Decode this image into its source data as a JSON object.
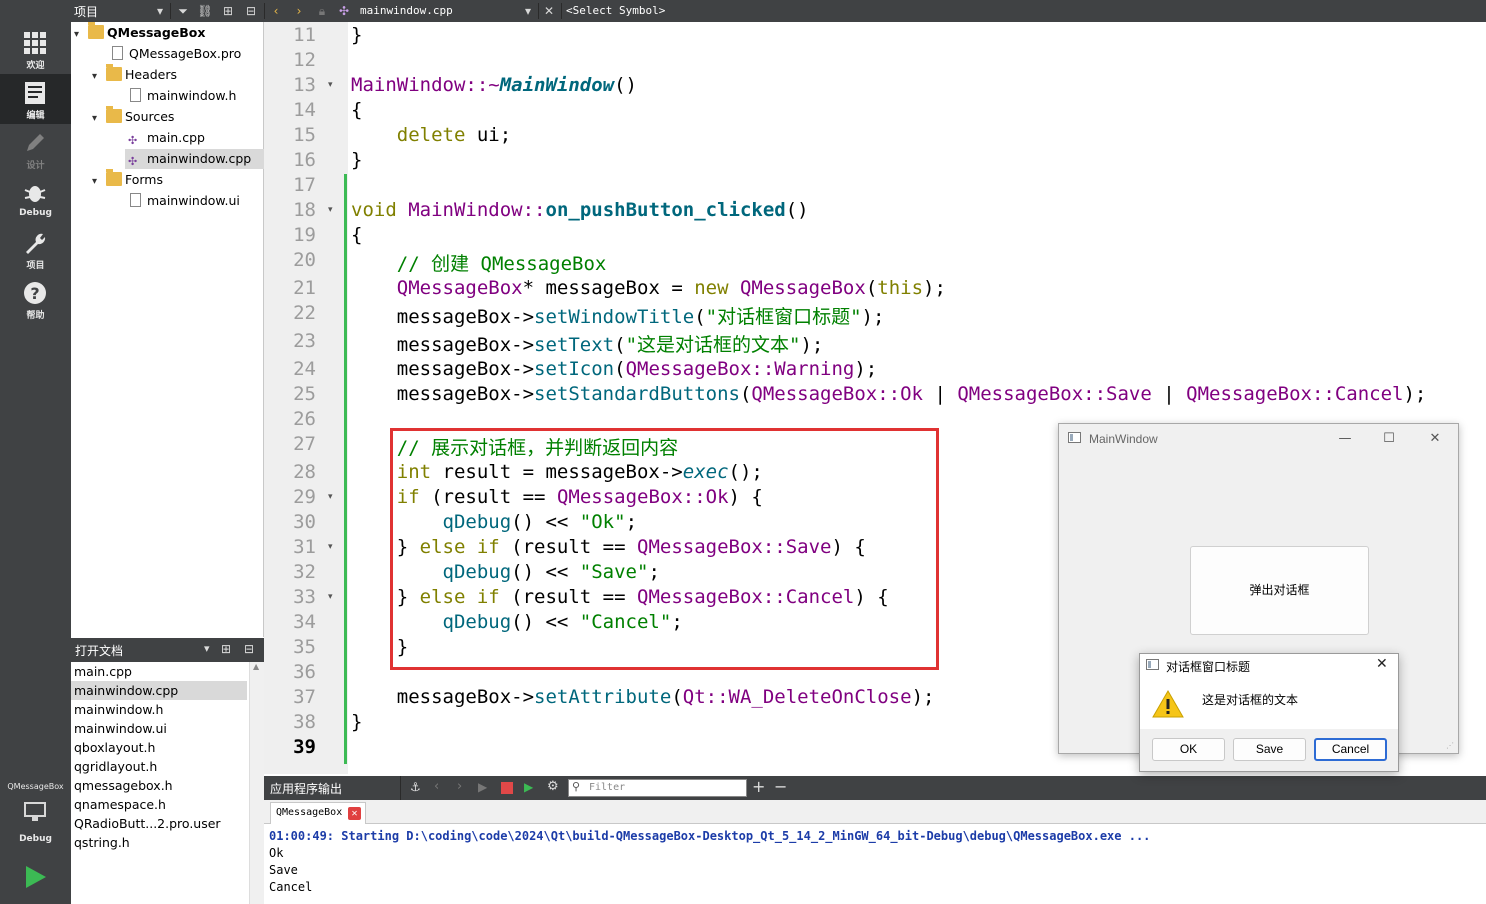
{
  "topbar": {
    "project_label": "项目",
    "file_name": "mainwindow.cpp",
    "symbol": "<Select Symbol>"
  },
  "modes": [
    {
      "label": "欢迎",
      "icon": "grid-icon"
    },
    {
      "label": "编辑",
      "icon": "document-icon"
    },
    {
      "label": "设计",
      "icon": "pencil-icon"
    },
    {
      "label": "Debug",
      "icon": "bug-icon"
    },
    {
      "label": "项目",
      "icon": "wrench-icon"
    },
    {
      "label": "帮助",
      "icon": "help-icon"
    }
  ],
  "kit": {
    "project": "QMessageBox",
    "mode": "Debug"
  },
  "tree": {
    "root": "QMessageBox",
    "pro": "QMessageBox.pro",
    "headers": "Headers",
    "header_files": [
      "mainwindow.h"
    ],
    "sources": "Sources",
    "source_files": [
      "main.cpp",
      "mainwindow.cpp"
    ],
    "forms": "Forms",
    "form_files": [
      "mainwindow.ui"
    ]
  },
  "open_docs": {
    "title": "打开文档",
    "files": [
      "main.cpp",
      "mainwindow.cpp",
      "mainwindow.h",
      "mainwindow.ui",
      "qboxlayout.h",
      "qgridlayout.h",
      "qmessagebox.h",
      "qnamespace.h",
      "QRadioButt...2.pro.user",
      "qstring.h"
    ],
    "selected": "mainwindow.cpp"
  },
  "editor": {
    "line_numbers": [
      "11",
      "12",
      "13",
      "14",
      "15",
      "16",
      "17",
      "18",
      "19",
      "20",
      "21",
      "22",
      "23",
      "24",
      "25",
      "26",
      "27",
      "28",
      "29",
      "30",
      "31",
      "32",
      "33",
      "34",
      "35",
      "36",
      "37",
      "38",
      "39"
    ],
    "current_line": "39",
    "code": {
      "l11_brace": "}",
      "l13_class": "MainWindow",
      "l13_sep": "::~",
      "l13_fn": "MainWindow",
      "l13_paren": "()",
      "l14_brace": "{",
      "l15_kw": "delete",
      "l15_rest": " ui;",
      "l16_brace": "}",
      "l18_kw": "void",
      "l18_class": "MainWindow",
      "l18_sep": "::",
      "l18_fn": "on_pushButton_clicked",
      "l18_paren": "()",
      "l19_brace": "{",
      "l20_comment": "// 创建 QMessageBox",
      "l21_type": "QMessageBox",
      "l21_star": "* messageBox = ",
      "l21_new": "new",
      "l21_type2": "QMessageBox",
      "l21_open": "(",
      "l21_this": "this",
      "l21_close": ");",
      "l22_obj": "messageBox->",
      "l22_fn": "setWindowTitle",
      "l22_open": "(",
      "l22_str": "\"对话框窗口标题\"",
      "l22_close": ");",
      "l23_obj": "messageBox->",
      "l23_fn": "setText",
      "l23_open": "(",
      "l23_str": "\"这是对话框的文本\"",
      "l23_close": ");",
      "l24_obj": "messageBox->",
      "l24_fn": "setIcon",
      "l24_open": "(",
      "l24_enum": "QMessageBox::Warning",
      "l24_close": ");",
      "l25_obj": "messageBox->",
      "l25_fn": "setStandardButtons",
      "l25_open": "(",
      "l25_enum1": "QMessageBox::Ok",
      "l25_pipe1": " | ",
      "l25_enum2": "QMessageBox::Save",
      "l25_pipe2": " | ",
      "l25_enum3": "QMessageBox::Cancel",
      "l25_close": ");",
      "l27_comment": "// 展示对话框，并判断返回内容",
      "l28_kw": "int",
      "l28_mid": " result = messageBox->",
      "l28_fn": "exec",
      "l28_close": "();",
      "l29_kw": "if",
      "l29_mid": " (result == ",
      "l29_enum": "QMessageBox::Ok",
      "l29_close": ") {",
      "l30_fn": "qDebug",
      "l30_mid": "() << ",
      "l30_str": "\"Ok\"",
      "l30_close": ";",
      "l31_open": "} ",
      "l31_kw": "else if",
      "l31_mid": " (result == ",
      "l31_enum": "QMessageBox::Save",
      "l31_close": ") {",
      "l32_fn": "qDebug",
      "l32_mid": "() << ",
      "l32_str": "\"Save\"",
      "l32_close": ";",
      "l33_open": "} ",
      "l33_kw": "else if",
      "l33_mid": " (result == ",
      "l33_enum": "QMessageBox::Cancel",
      "l33_close": ") {",
      "l34_fn": "qDebug",
      "l34_mid": "() << ",
      "l34_str": "\"Cancel\"",
      "l34_close": ";",
      "l35_brace": "}",
      "l37_obj": "messageBox->",
      "l37_fn": "setAttribute",
      "l37_open": "(",
      "l37_enum": "Qt::WA_DeleteOnClose",
      "l37_close": ");",
      "l38_brace": "}"
    }
  },
  "output": {
    "title": "应用程序输出",
    "filter_placeholder": "Filter",
    "tab": "QMessageBox",
    "lines": [
      "01:00:49: Starting D:\\coding\\code\\2024\\Qt\\build-QMessageBox-Desktop_Qt_5_14_2_MinGW_64_bit-Debug\\debug\\QMessageBox.exe ...",
      "Ok",
      "Save",
      "Cancel"
    ]
  },
  "main_window": {
    "title": "MainWindow",
    "button": "弹出对话框"
  },
  "message_box": {
    "title": "对话框窗口标题",
    "text": "这是对话框的文本",
    "buttons": [
      "OK",
      "Save",
      "Cancel"
    ],
    "default_button": "Cancel"
  },
  "colors": {
    "dark_panel": "#404244",
    "highlight_box": "#e03232",
    "keyword": "#808000",
    "type": "#800080",
    "function": "#00677c",
    "string": "#008000"
  }
}
